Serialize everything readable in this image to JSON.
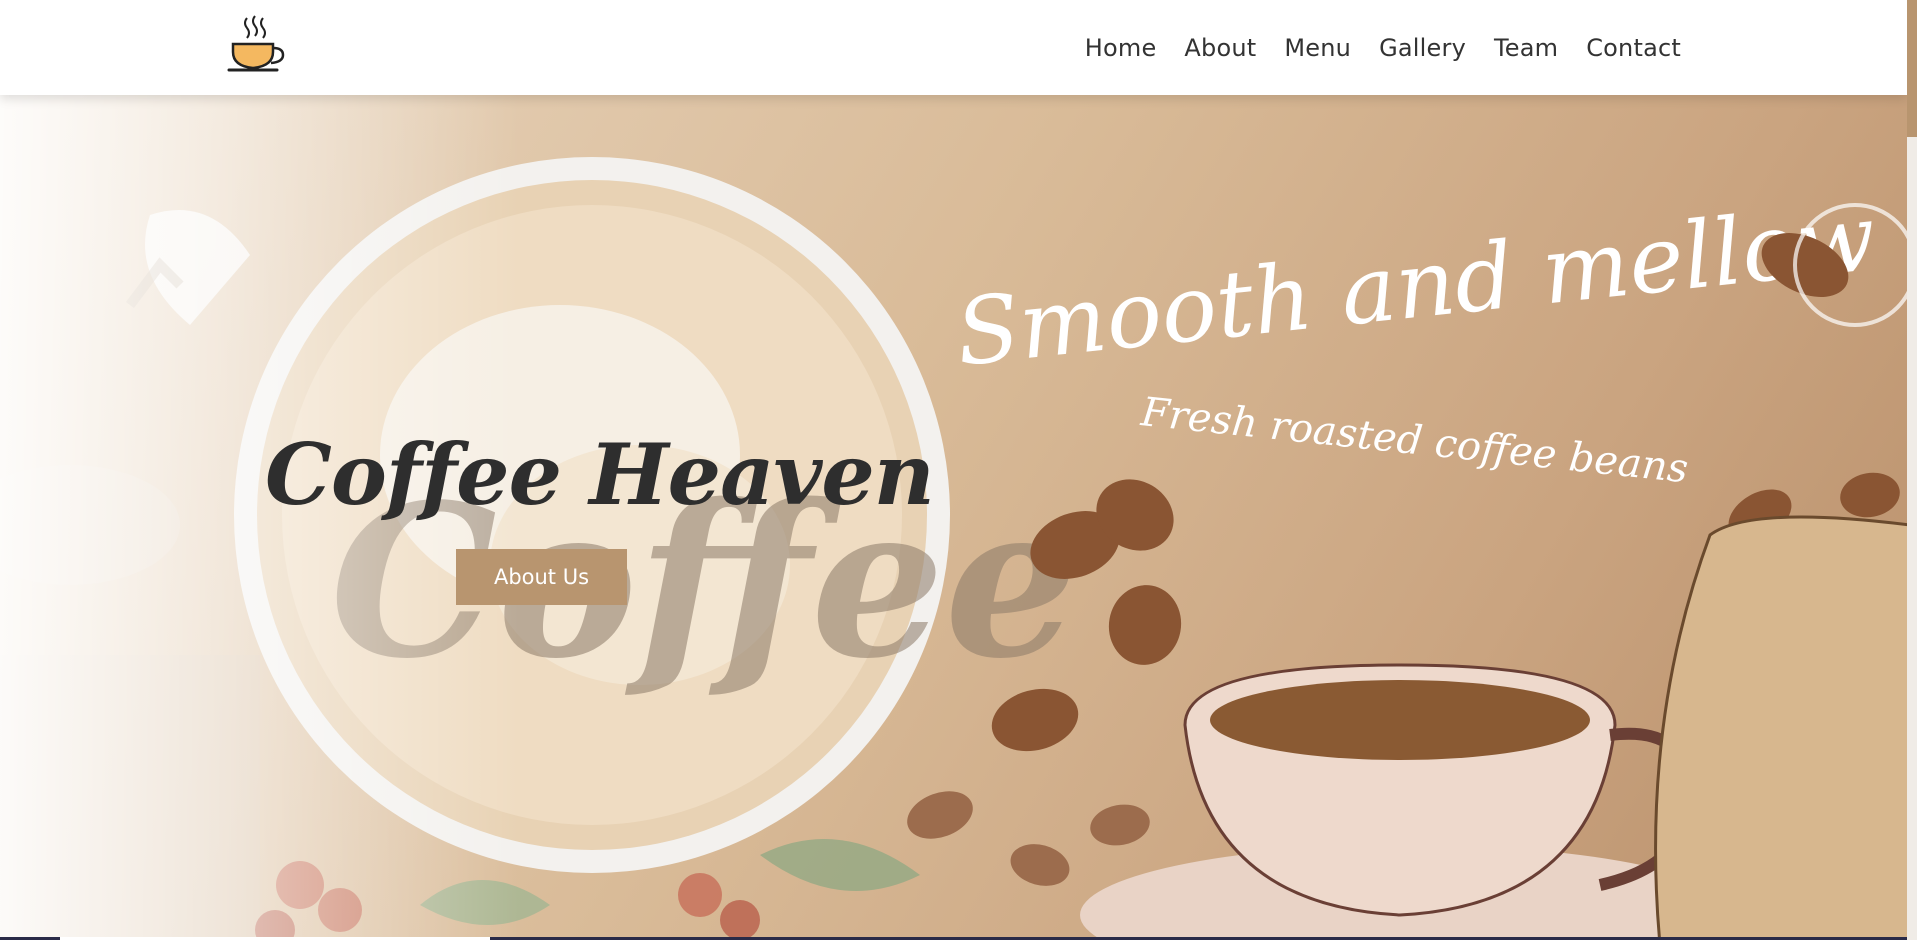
{
  "nav": {
    "logo_icon": "coffee-cup-icon",
    "links": [
      "Home",
      "About",
      "Menu",
      "Gallery",
      "Team",
      "Contact"
    ]
  },
  "hero": {
    "title": "Coffee Heaven",
    "button_label": "About Us",
    "art_text_main": "Smooth and mellow",
    "art_text_sub": "Fresh roasted coffee beans",
    "latte_art_text": "Coffee"
  },
  "colors": {
    "accent": "#b8956f",
    "title": "#2e2e2e",
    "nav_text": "#333333",
    "footer_strip": "#2a2b48"
  }
}
